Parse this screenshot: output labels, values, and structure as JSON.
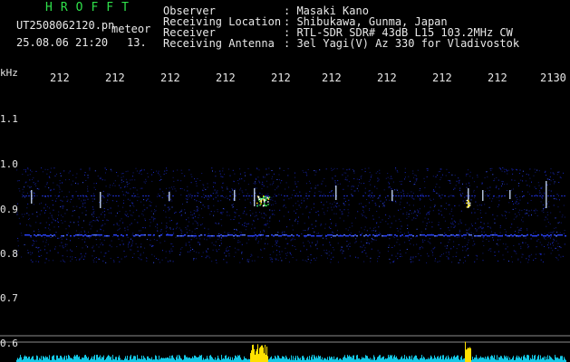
{
  "header": {
    "brand": "HROFFT",
    "filename": "UT2508062120.pn",
    "mode": "meteor",
    "timestamp": "25.08.06 21:20",
    "count": "13.",
    "fields": [
      {
        "label": "Observer",
        "value": ": Masaki Kano"
      },
      {
        "label": "Receiving Location",
        "value": ": Shibukawa, Gunma, Japan"
      },
      {
        "label": "Receiver",
        "value": ": RTL-SDR SDR# 43dB L15 103.2MHz CW"
      },
      {
        "label": "Receiving Antenna",
        "value": ": 3el Yagi(V) Az 330 for Vladivostok"
      }
    ]
  },
  "axes": {
    "unit": "kHz",
    "y_ticks": [
      "1.1",
      "1.0",
      "0.9",
      "0.8",
      "0.7",
      "0.6"
    ],
    "x_ticks": [
      "212",
      "212",
      "212",
      "212",
      "212",
      "212",
      "212",
      "212",
      "212",
      "2130"
    ]
  },
  "colors": {
    "background": "#000000",
    "text": "#e8e8e8",
    "brand": "#2fe04a",
    "noise": "#1a28c8",
    "signal": "#ffffff",
    "meter": "#14c8e6",
    "meter_peak": "#ffe000"
  }
}
